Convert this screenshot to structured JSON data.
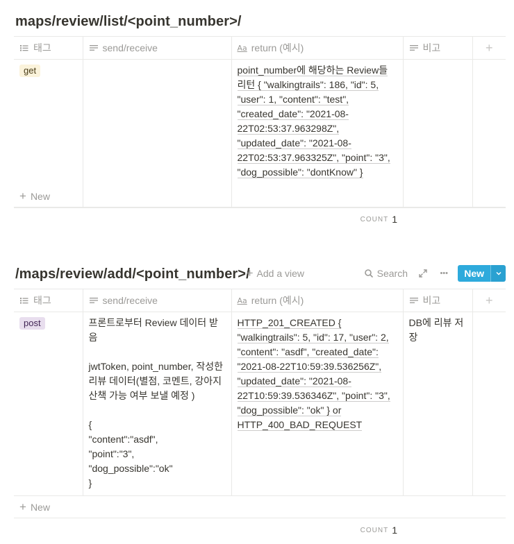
{
  "columns": {
    "tag": "태그",
    "send_receive": "send/receive",
    "return_example": "return (예시)",
    "note": "비고",
    "add": "+"
  },
  "db1": {
    "title": "maps/review/list/<point_number>/",
    "row": {
      "tag": "get",
      "tag_color": "#fbf3db",
      "send_receive": "",
      "return_example": "point_number에 해당하는 Review들 리턴 { \"walkingtrails\": 186, \"id\": 5, \"user\": 1, \"content\": \"test\", \"created_date\": \"2021-08-22T02:53:37.963298Z\", \"updated_date\": \"2021-08-22T02:53:37.963325Z\", \"point\": \"3\", \"dog_possible\": \"dontKnow\" }",
      "note": ""
    },
    "new_label": "New",
    "count_label": "COUNT",
    "count_value": "1"
  },
  "db2": {
    "title": "/maps/review/add/<point_number>/",
    "add_view": "Add a view",
    "search": "Search",
    "more": "•••",
    "new_button": "New",
    "row": {
      "tag": "post",
      "tag_color": "#e8deee",
      "send_receive": "프론트로부터 Review 데이터 받음\n\njwtToken, point_number, 작성한 리뷰 데이터(별점, 코멘트, 강아지 산책 가능 여부 보낼 예정 )\n\n{\n\"content\":\"asdf\",\n\"point\":\"3\",\n\"dog_possible\":\"ok\"\n}",
      "return_example": "HTTP_201_CREATED { \"walkingtrails\": 5, \"id\": 17, \"user\": 2, \"content\": \"asdf\", \"created_date\": \"2021-08-22T10:59:39.536256Z\", \"updated_date\": \"2021-08-22T10:59:39.536346Z\", \"point\": \"3\", \"dog_possible\": \"ok\" } or HTTP_400_BAD_REQUEST",
      "note": "DB에 리뷰 저장"
    },
    "new_label": "New",
    "count_label": "COUNT",
    "count_value": "1"
  },
  "accent_color": "#2eaadc"
}
